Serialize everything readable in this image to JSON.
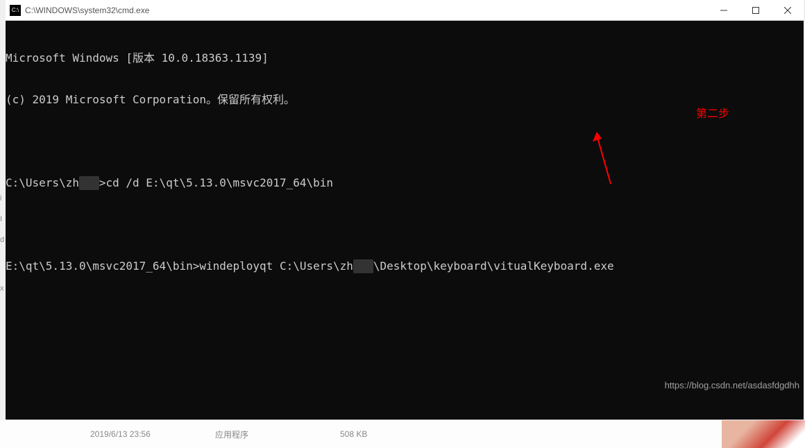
{
  "titlebar": {
    "title": "C:\\WINDOWS\\system32\\cmd.exe"
  },
  "terminal": {
    "line1": "Microsoft Windows [版本 10.0.18363.1139]",
    "line2": "(c) 2019 Microsoft Corporation。保留所有权利。",
    "prompt1_pre": "C:\\Users\\zh",
    "prompt1_post": ">cd /d E:\\qt\\5.13.0\\msvc2017_64\\bin",
    "prompt2_prefix": "E:\\qt\\5.13.0\\msvc2017_64\\bin>windeployqt C:\\Users\\zh",
    "prompt2_suffix": "\\Desktop\\keyboard\\vitualKeyboard.exe",
    "redacted": "   "
  },
  "annotation": {
    "label": "第二步"
  },
  "watermark": {
    "text": "https://blog.csdn.net/asdasfdgdhh"
  },
  "bottom": {
    "date": "2019/6/13 23:56",
    "type": "应用程序",
    "size": "508 KB"
  },
  "edge": {
    "t1": "i",
    "t2": "I",
    "t3": "d",
    "t4": "x"
  }
}
